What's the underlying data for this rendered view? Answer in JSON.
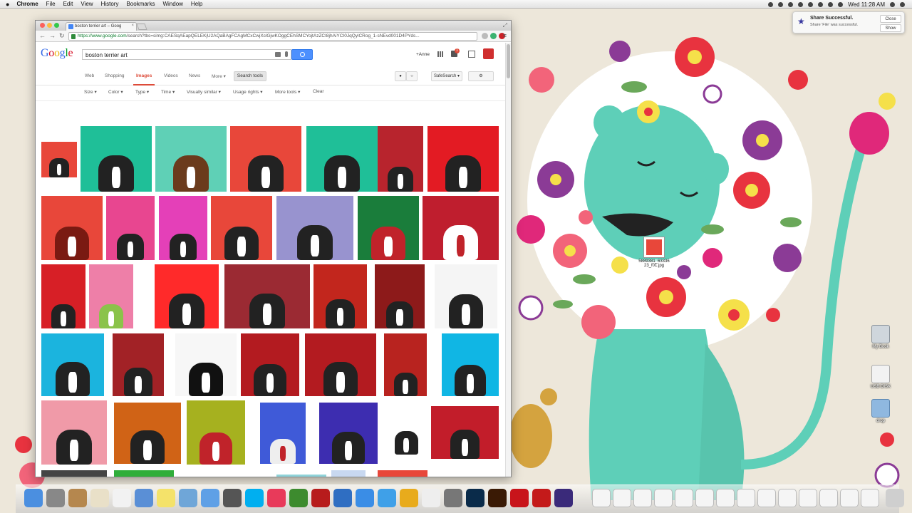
{
  "menubar": {
    "apple": "",
    "app_name": "Chrome",
    "menus": [
      "File",
      "Edit",
      "View",
      "History",
      "Bookmarks",
      "Window",
      "Help"
    ],
    "clock": "Wed 11:28 AM"
  },
  "notification": {
    "title": "Share Successful.",
    "message": "Share 'File' was successful.",
    "close_label": "Close",
    "show_label": "Show"
  },
  "browser": {
    "tab_title": "boston terrier art – Goog",
    "url_prefix": "https://www.google.com",
    "url_rest": "/search?tbs=simg:CAESqAEapQELEKjU2AQaBAgFCAgMCxCwjXclGjwKOggCEhSMCYojtAzZCI8jhAiYCI0JqQylCRog_1-sNEvd001D4PYds..."
  },
  "google": {
    "logo_letters": [
      "G",
      "o",
      "o",
      "g",
      "l",
      "e"
    ],
    "query": "boston terrier art",
    "user": "+Anne",
    "notif_count": "1",
    "nav_tabs": [
      "Web",
      "Shopping",
      "Images",
      "Videos",
      "News",
      "More ▾"
    ],
    "active_tab": "Images",
    "search_tools_label": "Search tools",
    "safesearch_label": "SafeSearch ▾",
    "filters": [
      "Size ▾",
      "Color ▾",
      "Type ▾",
      "Time ▾",
      "Visually similar ▾",
      "Usage rights ▾",
      "More tools ▾",
      "Clear"
    ]
  },
  "desktop": {
    "drag_file_label": "5889381_63336 23_f01.jpg",
    "icons": [
      "My Book",
      "USB DISK",
      "drop"
    ]
  },
  "colors": {
    "google_blue": "#4d90fe",
    "active_red": "#dd4b39",
    "lion_teal": "#5ecfb8"
  }
}
